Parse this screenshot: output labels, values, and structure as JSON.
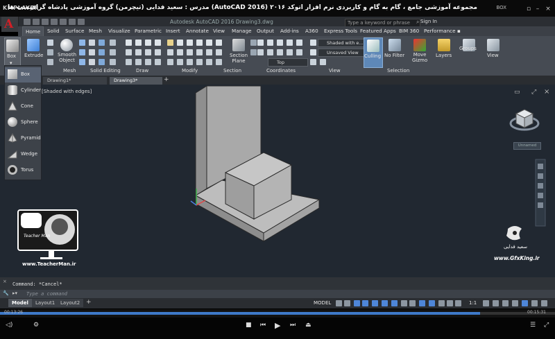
{
  "player": {
    "logo": "KMPLAYER",
    "title": "مجموعه آموزشی جامع ، گام به گام و کاربردی نرم افزار  اتوکد ۲۰۱۶ (AutoCAD 2016)  مدرس : سعید فدایی (تیچرمن) گروه آموزشی پادشاه گرافیست ها",
    "extra_label": "BOX",
    "time_current": "00:13:26",
    "time_total": "00:15:31",
    "progress_fraction": 0.865
  },
  "acad": {
    "app_title": "Autodesk AutoCAD 2016    Drawing3.dwg",
    "search_placeholder": "Type a keyword or phrase",
    "sign_in": "Sign In"
  },
  "ribbon_tabs": [
    "Home",
    "Solid",
    "Surface",
    "Mesh",
    "Visualize",
    "Parametric",
    "Insert",
    "Annotate",
    "View",
    "Manage",
    "Output",
    "Add-ins",
    "A360",
    "Express Tools",
    "Featured Apps",
    "BIM 360",
    "Performance"
  ],
  "ribbon": {
    "box_label": "Box",
    "extrude_label": "Extrude",
    "smooth_label": "Smooth\nObject",
    "section_plane_label": "Section\nPlane",
    "culling_label": "Culling",
    "no_filter_label": "No Filter",
    "move_gizmo_label": "Move\nGizmo",
    "layers_label": "Layers",
    "groups_label": "Groups",
    "view_label": "View",
    "visual_style_value": "Shaded with e...",
    "view_value": "Unsaved View",
    "ucs_value": "Top",
    "panels": {
      "mesh": "Mesh",
      "solid_editing": "Solid Editing",
      "draw": "Draw",
      "modify": "Modify",
      "section": "Section",
      "coordinates": "Coordinates",
      "view": "View",
      "selection": "Selection"
    }
  },
  "file_tabs": [
    "Drawing1*",
    "Drawing3*"
  ],
  "viewport": {
    "label": "[Shaded with edges]",
    "viewcube_label": "Unnamed"
  },
  "box_menu": [
    "Box",
    "Cylinder",
    "Cone",
    "Sphere",
    "Pyramid",
    "Wedge",
    "Torus"
  ],
  "command": {
    "history": "Command: *Cancel*",
    "prompt_placeholder": "Type a command"
  },
  "layout_tabs": [
    "Model",
    "Layout1",
    "Layout2"
  ],
  "status": {
    "model": "MODEL",
    "scale": "1:1"
  },
  "watermark": {
    "teacherman_url": "www.TeacherMan.ir",
    "teacherman_sign": "Teacher Man",
    "gfx_url": "www.GfxKing.ir",
    "gfx_name": "سعید فدایی"
  },
  "colors": {
    "viewport_bg": "#212831",
    "ribbon_bg": "#464b53",
    "autocad_red": "#d21f26"
  }
}
